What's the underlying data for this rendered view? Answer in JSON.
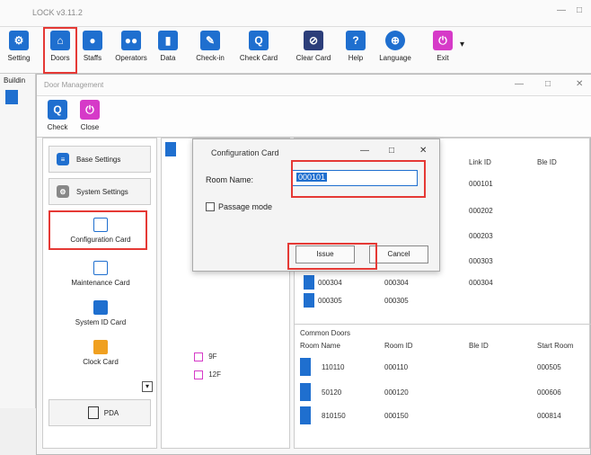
{
  "app": {
    "title": "LOCK v3.11.2",
    "window_controls": [
      "—",
      "□"
    ]
  },
  "toolbar": {
    "items": [
      {
        "label": "Setting",
        "icon": "gear-icon"
      },
      {
        "label": "Doors",
        "icon": "door-icon"
      },
      {
        "label": "Staffs",
        "icon": "staff-icon"
      },
      {
        "label": "Operators",
        "icon": "operators-icon"
      },
      {
        "label": "Data",
        "icon": "bar-chart-icon"
      },
      {
        "label": "Check-in",
        "icon": "key-icon"
      },
      {
        "label": "Check Card",
        "icon": "search-icon"
      },
      {
        "label": "Clear Card",
        "icon": "clear-icon"
      },
      {
        "label": "Help",
        "icon": "help-icon"
      },
      {
        "label": "Language",
        "icon": "globe-icon"
      },
      {
        "label": "Exit",
        "icon": "power-icon"
      }
    ]
  },
  "building": {
    "label": "Buildin"
  },
  "door_management": {
    "title": "Door Management",
    "window_controls": [
      "—",
      "□",
      "✕"
    ],
    "toolbar": {
      "check_label": "Check",
      "close_label": "Close"
    },
    "left_panel": {
      "base_settings": "Base Settings",
      "system_settings": "System Settings",
      "cards": [
        {
          "label": "Configuration Card"
        },
        {
          "label": "Maintenance Card"
        },
        {
          "label": "System ID Card"
        },
        {
          "label": "Clock Card"
        }
      ],
      "pda": "PDA"
    },
    "tree": {
      "floors": [
        "9F",
        "12F"
      ]
    },
    "rooms_table": {
      "columns": [
        "Link ID",
        "Ble ID"
      ],
      "rows": [
        {
          "link_id": "000101"
        },
        {
          "link_id": "000202"
        },
        {
          "link_id": "000203"
        },
        {
          "link_id": "000303"
        },
        {
          "room": "000304",
          "room_id": "000304",
          "link_id": "000304"
        },
        {
          "room": "000305",
          "room_id": "000305",
          "link_id": ""
        }
      ]
    },
    "common_doors": {
      "title": "Common Doors",
      "columns": [
        "Room Name",
        "Room ID",
        "Ble ID",
        "Start Room"
      ],
      "rows": [
        {
          "room_name": "110110",
          "room_id": "000110",
          "ble_id": "",
          "start_room": "000505"
        },
        {
          "room_name": "50120",
          "room_id": "000120",
          "ble_id": "",
          "start_room": "000606"
        },
        {
          "room_name": "810150",
          "room_id": "000150",
          "ble_id": "",
          "start_room": "000814"
        }
      ]
    }
  },
  "dialog": {
    "title": "Configuration Card",
    "controls": [
      "—",
      "□",
      "✕"
    ],
    "room_name_label": "Room Name:",
    "room_name_value": "000101",
    "passage_mode_label": "Passage mode",
    "issue_label": "Issue",
    "cancel_label": "Cancel"
  },
  "colors": {
    "accent_blue": "#1f6fcf",
    "accent_purple": "#d63ac8",
    "highlight_red": "#e53935"
  }
}
